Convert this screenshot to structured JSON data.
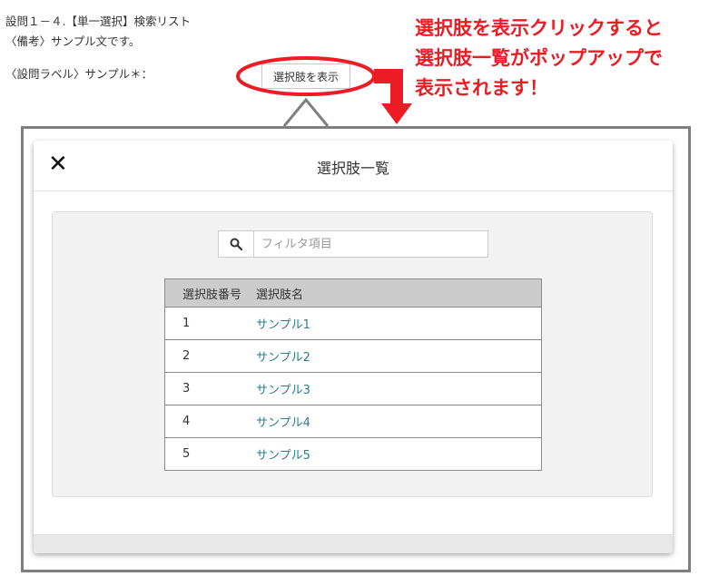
{
  "question": {
    "title": "設問１－４.【単一選択】検索リスト",
    "note": "〈備考〉サンプル文です。",
    "label": "〈設問ラベル〉サンプル＊："
  },
  "show_button_label": "選択肢を表示",
  "annotation": {
    "lines": [
      "選択肢を表示クリックすると",
      "選択肢一覧がポップアップで",
      "表示されます！"
    ],
    "color": "#ec1c24"
  },
  "modal": {
    "close_glyph": "✕",
    "title": "選択肢一覧",
    "search": {
      "placeholder": "フィルタ項目",
      "value": ""
    },
    "table": {
      "headers": [
        "選択肢番号",
        "選択肢名"
      ],
      "rows": [
        {
          "no": "1",
          "name": "サンプル1"
        },
        {
          "no": "2",
          "name": "サンプル2"
        },
        {
          "no": "3",
          "name": "サンプル3"
        },
        {
          "no": "4",
          "name": "サンプル4"
        },
        {
          "no": "5",
          "name": "サンプル5"
        }
      ]
    }
  }
}
